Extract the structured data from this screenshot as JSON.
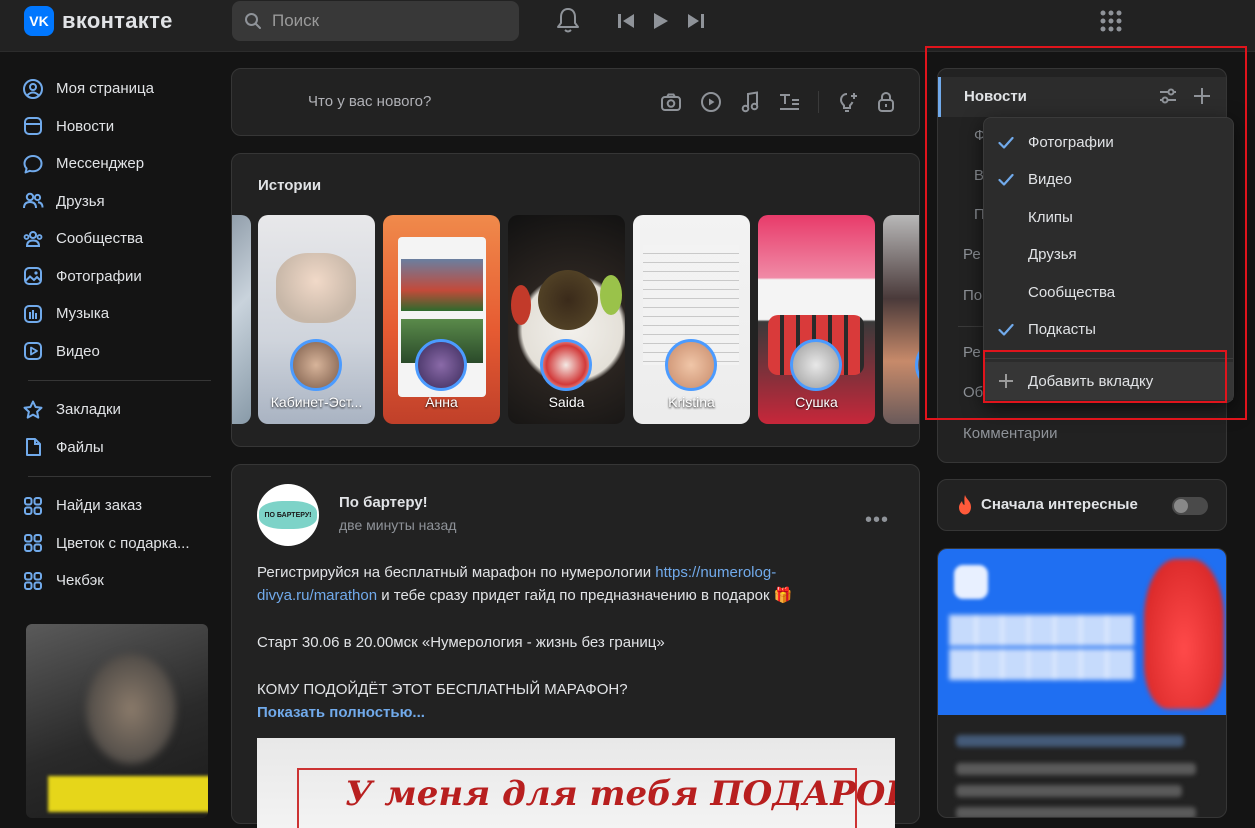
{
  "colors": {
    "accent": "#71aaeb",
    "brand": "#0077ff",
    "highlight": "#e0141c"
  },
  "header": {
    "logo_mark": "VK",
    "logo_text": "вконтакте",
    "search_placeholder": "Поиск"
  },
  "sidebar": {
    "items": [
      {
        "label": "Моя страница",
        "icon": "user-circle-icon"
      },
      {
        "label": "Новости",
        "icon": "news-icon"
      },
      {
        "label": "Мессенджер",
        "icon": "message-icon"
      },
      {
        "label": "Друзья",
        "icon": "friends-icon"
      },
      {
        "label": "Сообщества",
        "icon": "communities-icon"
      },
      {
        "label": "Фотографии",
        "icon": "photo-icon"
      },
      {
        "label": "Музыка",
        "icon": "music-icon"
      },
      {
        "label": "Видео",
        "icon": "video-icon"
      }
    ],
    "items2": [
      {
        "label": "Закладки",
        "icon": "star-icon"
      },
      {
        "label": "Файлы",
        "icon": "file-icon"
      }
    ],
    "apps": [
      {
        "label": "Найди заказ",
        "icon": "apps-icon"
      },
      {
        "label": "Цветок с подарка...",
        "icon": "apps-icon"
      },
      {
        "label": "Чекбэк",
        "icon": "apps-icon"
      }
    ]
  },
  "composer": {
    "placeholder": "Что у вас нового?"
  },
  "stories": {
    "title": "Истории",
    "items": [
      {
        "name": "Кабинет-Эст..."
      },
      {
        "name": "Анна"
      },
      {
        "name": "Saida"
      },
      {
        "name": "Kristina"
      },
      {
        "name": "Сушка"
      }
    ]
  },
  "post": {
    "author": "По бартеру!",
    "avatar_text": "ПО БАРТЕРУ!",
    "time": "две минуты назад",
    "text1_a": "Регистрируйся на бесплатный марафон по нумерологии ",
    "link": "https://numerolog-divya.ru/marathon",
    "text1_b": " и тебе сразу придет гайд по предназначению в подарок 🎁",
    "text2": "Старт 30.06 в 20.00мск «Нумерология - жизнь без границ»",
    "text3": "КОМУ ПОДОЙДЁТ ЭТОТ БЕСПЛАТНЫЙ МАРАФОН?",
    "show_more": "Показать полностью...",
    "image_text": "У меня для тебя ПОДАРОК"
  },
  "feed_menu": {
    "active": "Новости",
    "hidden_prefixes": [
      "Ф",
      "В",
      "П",
      "Ре",
      "По",
      "Ре",
      "Об"
    ],
    "comments": "Комментарии"
  },
  "dropdown": {
    "items": [
      {
        "label": "Фотографии",
        "checked": true
      },
      {
        "label": "Видео",
        "checked": true
      },
      {
        "label": "Клипы",
        "checked": false
      },
      {
        "label": "Друзья",
        "checked": false
      },
      {
        "label": "Сообщества",
        "checked": false
      },
      {
        "label": "Подкасты",
        "checked": true
      }
    ],
    "add_tab": "Добавить вкладку"
  },
  "sort": {
    "label": "Сначала интересные",
    "enabled": false
  }
}
